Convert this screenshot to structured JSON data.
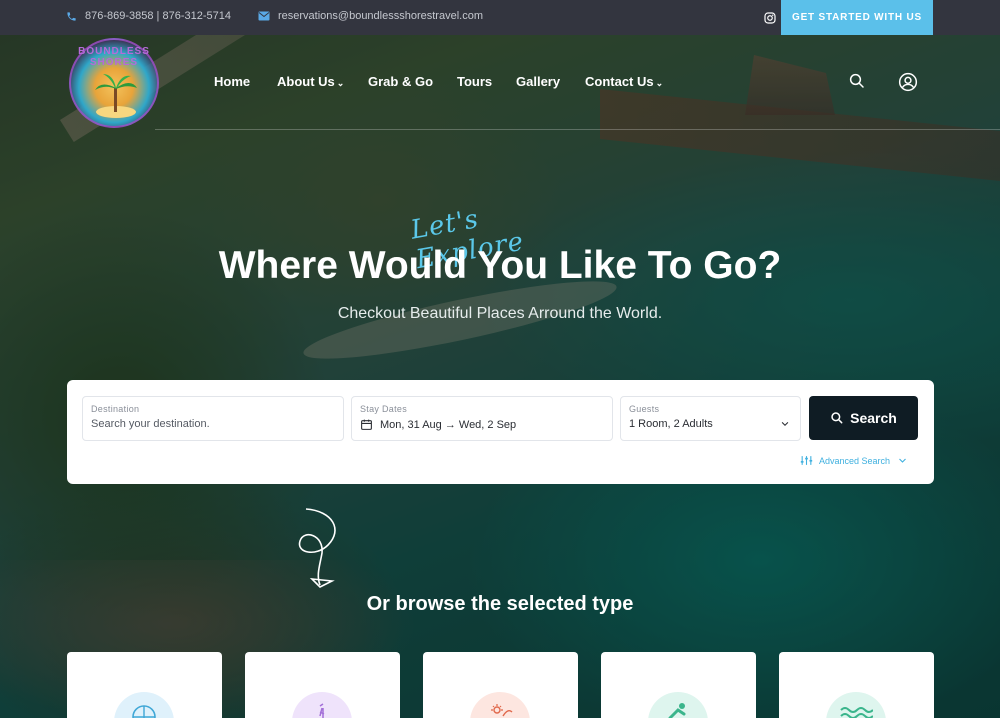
{
  "topbar": {
    "phones": "876-869-3858 | 876-312-5714",
    "email": "reservations@boundlessshorestravel.com",
    "cta_label": "GET STARTED WITH US"
  },
  "brand": {
    "logo_text": "BOUNDLESS SHORES"
  },
  "nav": {
    "items": [
      {
        "label": "Home",
        "has_dropdown": false
      },
      {
        "label": "About Us",
        "has_dropdown": true
      },
      {
        "label": "Grab & Go",
        "has_dropdown": false
      },
      {
        "label": "Tours",
        "has_dropdown": false
      },
      {
        "label": "Gallery",
        "has_dropdown": false
      },
      {
        "label": "Contact Us",
        "has_dropdown": true
      }
    ],
    "icons": [
      "search-icon",
      "user-icon"
    ]
  },
  "hero": {
    "script": "Let's Explore",
    "headline": "Where Would You Like To Go?",
    "subline": "Checkout Beautiful Places Arround the World."
  },
  "search": {
    "destination": {
      "label": "Destination",
      "placeholder": "Search your destination."
    },
    "dates": {
      "label": "Stay Dates",
      "value": "Mon, 31 Aug → Wed, 2 Sep"
    },
    "guests": {
      "label": "Guests",
      "value": "1 Room, 2 Adults"
    },
    "button_label": "Search",
    "advanced_label": "Advanced Search"
  },
  "browse": {
    "title": "Or browse the selected type",
    "types": [
      {
        "icon": "globe-icon",
        "color": "#dff1fb",
        "accent": "#3fa7d6"
      },
      {
        "icon": "hiker-icon",
        "color": "#efe3fb",
        "accent": "#a36fd8"
      },
      {
        "icon": "beach-icon",
        "color": "#fde6e0",
        "accent": "#e0674a"
      },
      {
        "icon": "swimmer-icon",
        "color": "#def5ee",
        "accent": "#3bb58c"
      },
      {
        "icon": "waves-icon",
        "color": "#def5ee",
        "accent": "#3bb58c"
      }
    ]
  },
  "colors": {
    "accent": "#5bc0ea",
    "topbar": "#33353f",
    "search_button": "#0f1c24"
  }
}
